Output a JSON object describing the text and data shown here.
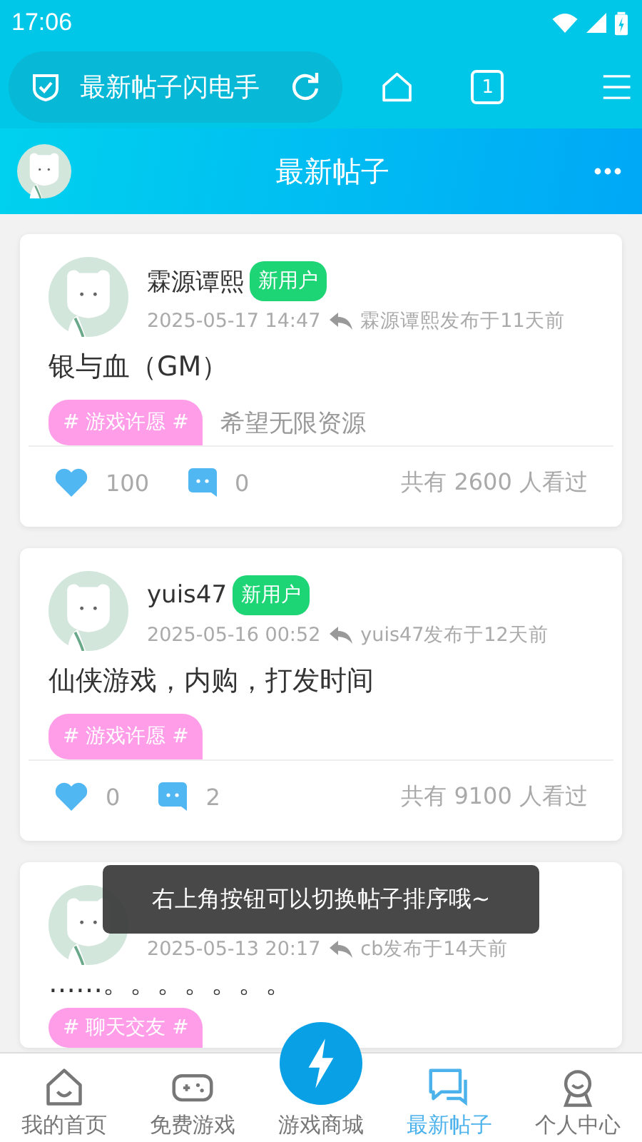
{
  "status_bar": {
    "time": "17:06"
  },
  "browser_bar": {
    "address": "最新帖子闪电手",
    "tab_count": "1"
  },
  "header": {
    "title": "最新帖子"
  },
  "posts": [
    {
      "author": "霖源谭熙",
      "badge": "新用户",
      "time": "2025-05-17 14:47",
      "reply_note": "霖源谭熙发布于11天前",
      "content": "银与血（GM）",
      "tag": "# 游戏许愿 #",
      "extra": "希望无限资源",
      "likes": "100",
      "comments": "0",
      "views": "共有 2600 人看过"
    },
    {
      "author": "yuis47",
      "badge": "新用户",
      "time": "2025-05-16 00:52",
      "reply_note": "yuis47发布于12天前",
      "content": "仙侠游戏，内购，打发时间",
      "tag": "# 游戏许愿 #",
      "likes": "0",
      "comments": "2",
      "views": "共有 9100 人看过"
    },
    {
      "time": "2025-05-13 20:17",
      "reply_note": "cb发布于14天前",
      "content": "……。。。。。。。",
      "tag": "# 聊天交友 #"
    }
  ],
  "toast": "右上角按钮可以切换帖子排序哦~",
  "nav": [
    {
      "kind": "home",
      "label": "我的首页",
      "selected": false
    },
    {
      "kind": "games",
      "label": "免费游戏",
      "selected": false
    },
    {
      "kind": "store",
      "label": "游戏商城",
      "selected": false
    },
    {
      "kind": "posts",
      "label": "最新帖子",
      "selected": true
    },
    {
      "kind": "profile",
      "label": "个人中心",
      "selected": false
    }
  ]
}
